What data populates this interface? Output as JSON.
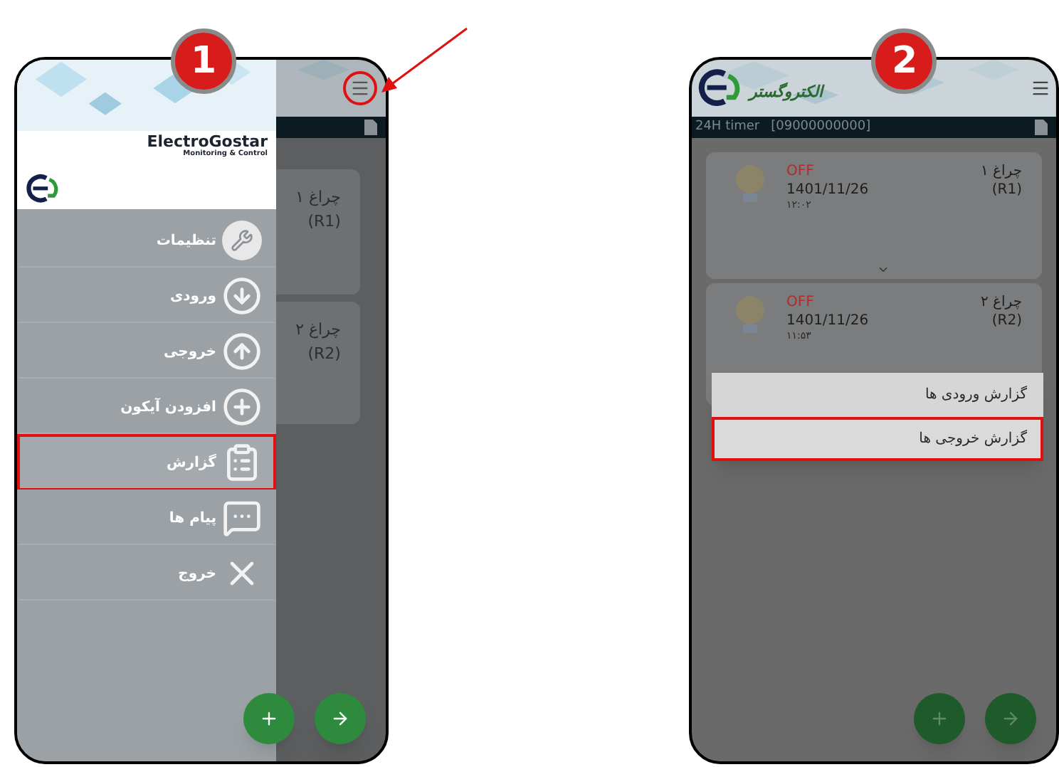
{
  "step_1": {
    "badge": "1",
    "app": {
      "cards": [
        {
          "name": "چراغ ۱",
          "relay": "(R1)"
        },
        {
          "name": "چراغ ۲",
          "relay": "(R2)"
        }
      ]
    },
    "drawer": {
      "brand": "ElectroGostar",
      "tagline": "Monitoring & Control",
      "items": [
        {
          "label": "تنظیمات",
          "kind": "wrench",
          "selected": false
        },
        {
          "label": "ورودی",
          "kind": "down",
          "selected": false
        },
        {
          "label": "خروجی",
          "kind": "up",
          "selected": false
        },
        {
          "label": "افزودن آیکون",
          "kind": "plus",
          "selected": false
        },
        {
          "label": "گزارش",
          "kind": "report",
          "selected": true
        },
        {
          "label": "پیام ها",
          "kind": "message",
          "selected": false
        },
        {
          "label": "خروج",
          "kind": "exit",
          "selected": false
        }
      ]
    }
  },
  "step_2": {
    "badge": "2",
    "app": {
      "logo_text": "الکتروگستر",
      "device": "24H timer",
      "phone": "[09000000000]",
      "cards": [
        {
          "status": "OFF",
          "date": "1401/11/26",
          "time": "۱۲:۰۲",
          "name": "چراغ ۱",
          "relay": "(R1)"
        },
        {
          "status": "OFF",
          "date": "1401/11/26",
          "time": "۱۱:۵۳",
          "name": "چراغ ۲",
          "relay": "(R2)"
        }
      ]
    },
    "menu": [
      {
        "label": "گزارش ورودی ها",
        "selected": false
      },
      {
        "label": "گزارش خروجی ها",
        "selected": true
      }
    ]
  }
}
